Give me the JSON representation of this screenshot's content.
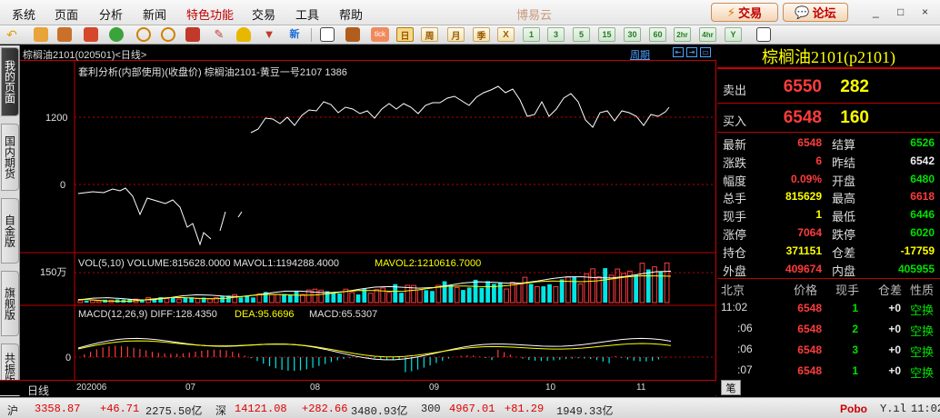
{
  "menu": {
    "items": [
      "系统",
      "页面",
      "分析",
      "新闻",
      "特色功能",
      "交易",
      "工具",
      "帮助"
    ],
    "app_title": "博易云",
    "trade_button": "交易",
    "forum_button": "论坛",
    "window_controls": [
      "_",
      "□",
      "×"
    ]
  },
  "toolbar": {
    "icons": [
      "back-icon",
      "home-icon",
      "layers-icon",
      "screen-icon",
      "refresh-icon",
      "zoom-in-icon",
      "zoom-out-icon",
      "window-icon",
      "pen-icon",
      "magic-hat-icon",
      "filter-icon",
      "news-icon",
      "list-icon",
      "tick-icon"
    ],
    "news_label": "新",
    "tick_label": "tick",
    "periods": [
      "日",
      "周",
      "月",
      "季",
      "X",
      "1",
      "3",
      "5",
      "15",
      "30",
      "60",
      "2hr",
      "4hr",
      "Y"
    ],
    "active_period": "日"
  },
  "left_tabs": [
    "我的页面",
    "国内期货",
    "自金版",
    "旗舰版",
    "共振版"
  ],
  "chart": {
    "header_label": "棕榈油2101(020501)<日线>",
    "period_link": "周期",
    "main_title": "套利分析(内部使用)(收盘价) 棕榈油2101-黄豆一号2107",
    "main_value": "1386",
    "main_ticks": [
      "1200",
      "0"
    ],
    "vol_title_white": "VOL(5,10) VOLUME:815628.0000 MAVOL1:1194288.4000",
    "vol_title_yellow": "MAVOL2:1210616.7000",
    "vol_tick": "150万",
    "macd_title_white": "MACD(12,26,9) DIFF:128.4350",
    "macd_title_yellow": "DEA:95.6696",
    "macd_title_white2": "MACD:65.5307",
    "macd_tick": "0",
    "x_axis_label": "日线",
    "x_ticks": [
      "202006",
      "07",
      "08",
      "09",
      "10",
      "11"
    ]
  },
  "quote": {
    "title": "棕榈油2101(p2101)",
    "sell_label": "卖出",
    "sell_price": "6550",
    "sell_qty": "282",
    "buy_label": "买入",
    "buy_price": "6548",
    "buy_qty": "160",
    "rows": [
      {
        "l1": "最新",
        "v1": "6548",
        "c1": "red",
        "l2": "结算",
        "v2": "6526",
        "c2": "green"
      },
      {
        "l1": "涨跌",
        "v1": "6",
        "c1": "red",
        "l2": "昨结",
        "v2": "6542",
        "c2": "white"
      },
      {
        "l1": "幅度",
        "v1": "0.09%",
        "c1": "red",
        "l2": "开盘",
        "v2": "6480",
        "c2": "green"
      },
      {
        "l1": "总手",
        "v1": "815629",
        "c1": "yellow",
        "l2": "最高",
        "v2": "6618",
        "c2": "red"
      },
      {
        "l1": "现手",
        "v1": "1",
        "c1": "yellow",
        "l2": "最低",
        "v2": "6446",
        "c2": "green"
      },
      {
        "l1": "涨停",
        "v1": "7064",
        "c1": "red",
        "l2": "跌停",
        "v2": "6020",
        "c2": "green"
      },
      {
        "l1": "持仓",
        "v1": "371151",
        "c1": "yellow",
        "l2": "仓差",
        "v2": "-17759",
        "c2": "yellow"
      },
      {
        "l1": "外盘",
        "v1": "409674",
        "c1": "red",
        "l2": "内盘",
        "v2": "405955",
        "c2": "green"
      }
    ],
    "tick_headers": [
      "北京",
      "价格",
      "现手",
      "仓差",
      "性质"
    ],
    "ticks": [
      {
        "time": "11:02",
        "price": "6548",
        "qty": "1",
        "diff": "+0",
        "nature": "空换"
      },
      {
        "time": ":06",
        "price": "6548",
        "qty": "2",
        "diff": "+0",
        "nature": "空换"
      },
      {
        "time": ":06",
        "price": "6548",
        "qty": "3",
        "diff": "+0",
        "nature": "空换"
      },
      {
        "time": ":07",
        "price": "6548",
        "qty": "1",
        "diff": "+0",
        "nature": "空换"
      }
    ],
    "tab_label": "笔"
  },
  "status": {
    "sh_label": "沪",
    "sh_index": "3358.87",
    "sh_change": "+46.71",
    "sh_amount": "2275.50亿",
    "sz_label": "深",
    "sz_index": "14121.08",
    "sz_change": "+282.66",
    "sz_amount": "3480.93亿",
    "hs_label": "300",
    "hs_index": "4967.01",
    "hs_change": "+81.29",
    "hs_amount": "1949.33亿",
    "brand": "Pobo",
    "signal": "Y.ıl",
    "time": "11:02"
  },
  "colors": {
    "up": "#ff3c3c",
    "down": "#00e000",
    "emphasis": "#ffff00",
    "grid": "#c00000",
    "vol_up": "#ff3c3c",
    "vol_down": "#00e5e5"
  }
}
